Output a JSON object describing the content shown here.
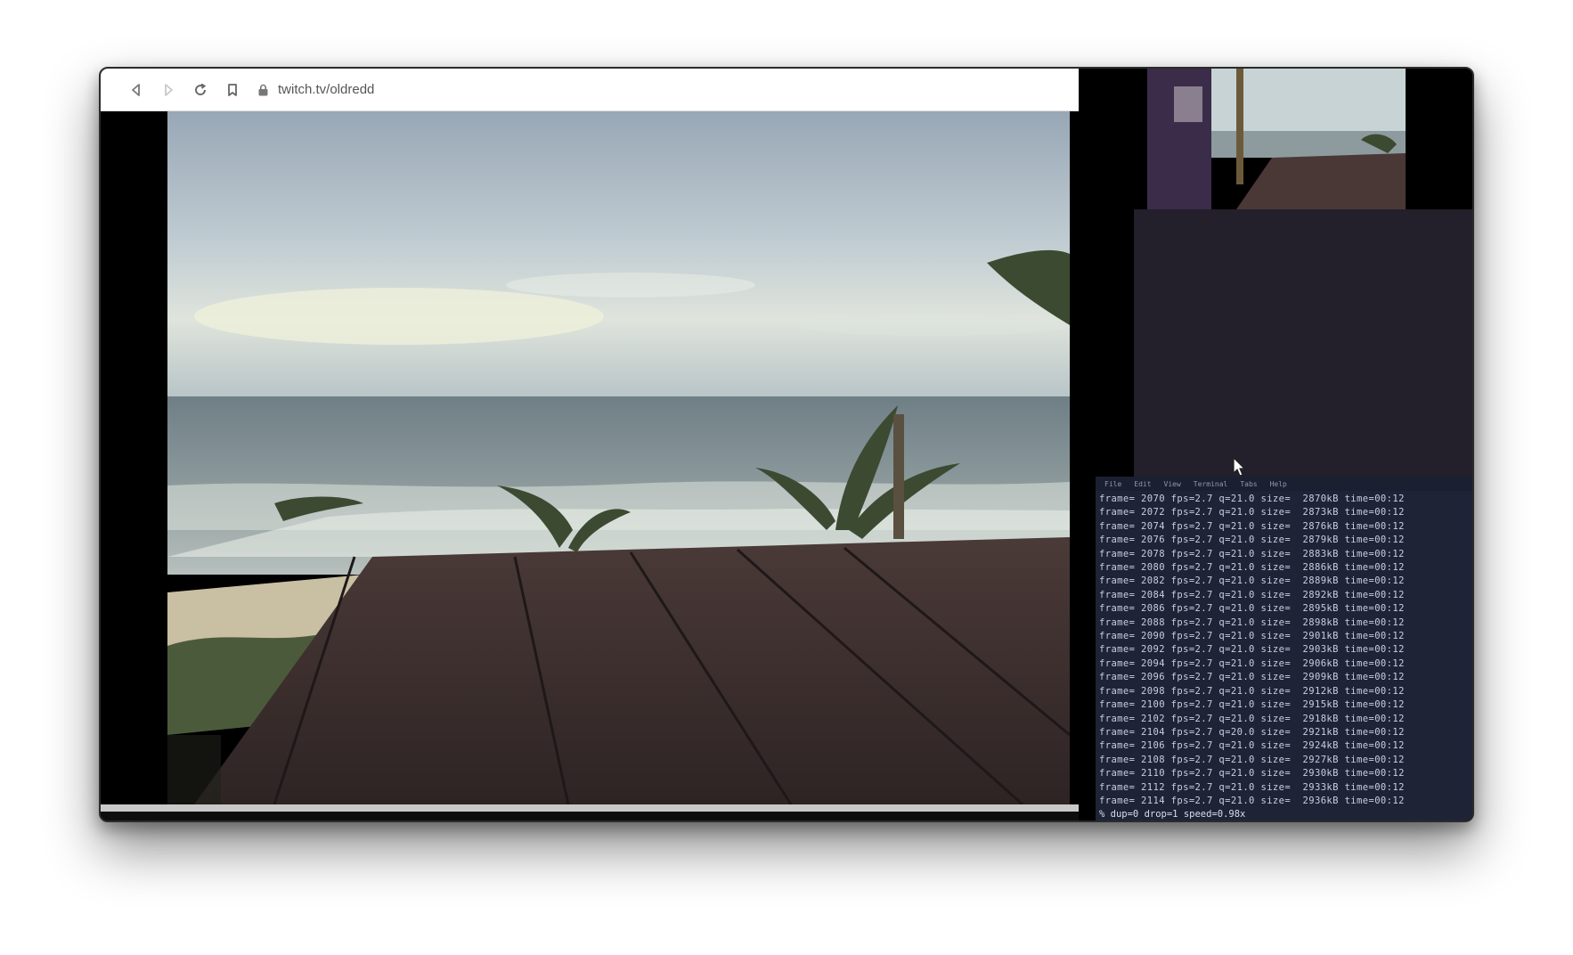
{
  "browser": {
    "url": "twitch.tv/oldredd",
    "icons": [
      "back-icon",
      "forward-icon",
      "reload-icon",
      "bookmark-icon",
      "lock-icon"
    ]
  },
  "terminal": {
    "menu": [
      "File",
      "Edit",
      "View",
      "Terminal",
      "Tabs",
      "Help"
    ],
    "lines": [
      "frame= 2070 fps=2.7 q=21.0 size=  2870kB time=00:12",
      "frame= 2072 fps=2.7 q=21.0 size=  2873kB time=00:12",
      "frame= 2074 fps=2.7 q=21.0 size=  2876kB time=00:12",
      "frame= 2076 fps=2.7 q=21.0 size=  2879kB time=00:12",
      "frame= 2078 fps=2.7 q=21.0 size=  2883kB time=00:12",
      "frame= 2080 fps=2.7 q=21.0 size=  2886kB time=00:12",
      "frame= 2082 fps=2.7 q=21.0 size=  2889kB time=00:12",
      "frame= 2084 fps=2.7 q=21.0 size=  2892kB time=00:12",
      "frame= 2086 fps=2.7 q=21.0 size=  2895kB time=00:12",
      "frame= 2088 fps=2.7 q=21.0 size=  2898kB time=00:12",
      "frame= 2090 fps=2.7 q=21.0 size=  2901kB time=00:12",
      "frame= 2092 fps=2.7 q=21.0 size=  2903kB time=00:12",
      "frame= 2094 fps=2.7 q=21.0 size=  2906kB time=00:12",
      "frame= 2096 fps=2.7 q=21.0 size=  2909kB time=00:12",
      "frame= 2098 fps=2.7 q=21.0 size=  2912kB time=00:12",
      "frame= 2100 fps=2.7 q=21.0 size=  2915kB time=00:12",
      "frame= 2102 fps=2.7 q=21.0 size=  2918kB time=00:12",
      "frame= 2104 fps=2.7 q=20.0 size=  2921kB time=00:12",
      "frame= 2106 fps=2.7 q=21.0 size=  2924kB time=00:12",
      "frame= 2108 fps=2.7 q=21.0 size=  2927kB time=00:12",
      "frame= 2110 fps=2.7 q=21.0 size=  2930kB time=00:12",
      "frame= 2112 fps=2.7 q=21.0 size=  2933kB time=00:12",
      "frame= 2114 fps=2.7 q=21.0 size=  2936kB time=00:12"
    ],
    "status": "% dup=0 drop=1 speed=0.98x"
  }
}
